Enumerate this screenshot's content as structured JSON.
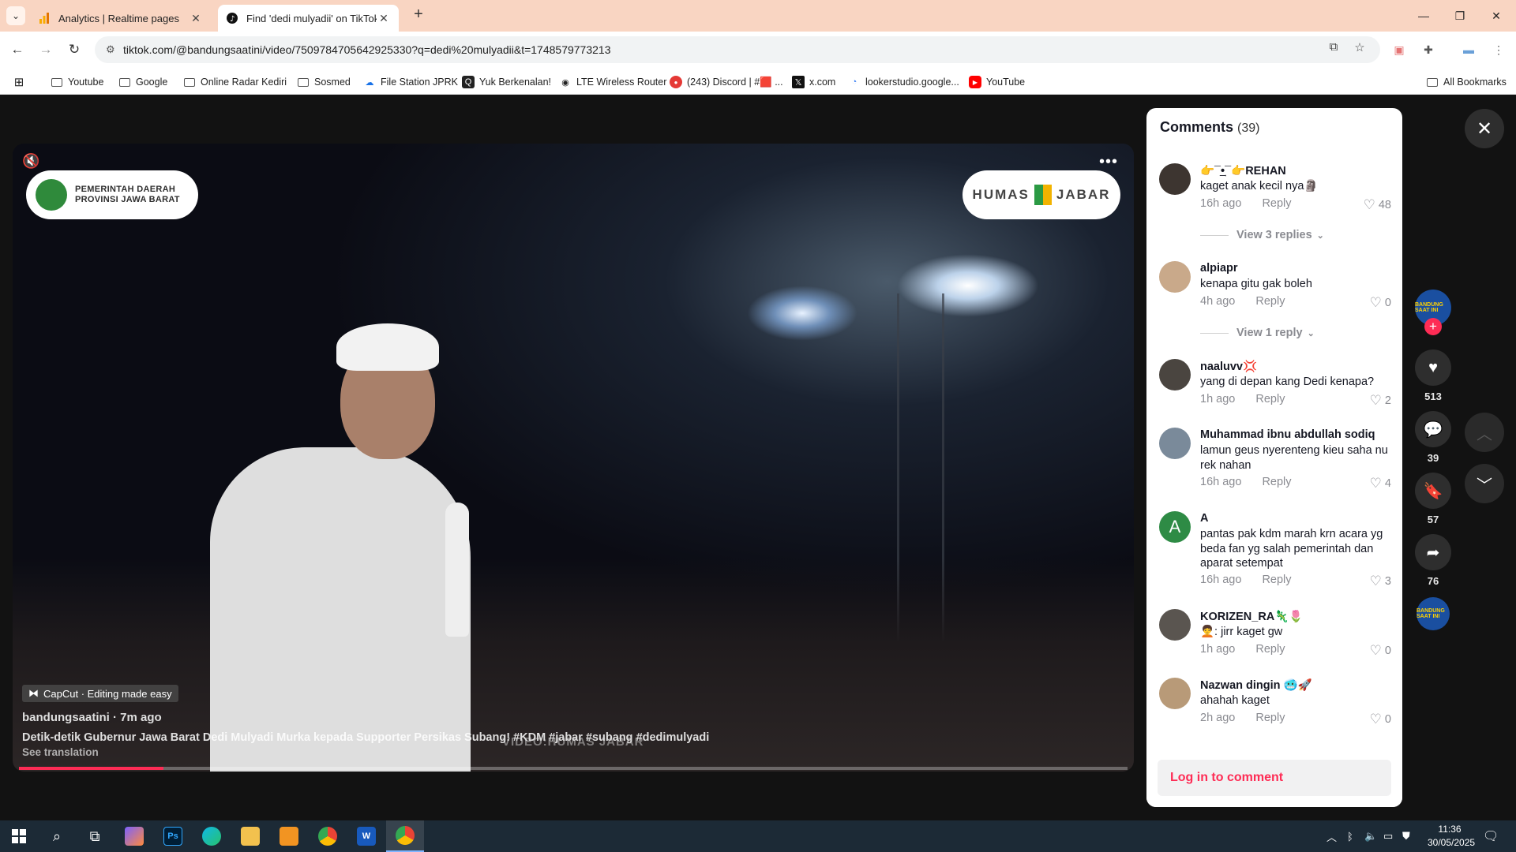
{
  "browser": {
    "tabs": [
      {
        "title": "Analytics | Realtime pages",
        "active": false,
        "icon": "analytics-icon"
      },
      {
        "title": "Find 'dedi mulyadii' on TikTok |",
        "active": true,
        "icon": "tiktok-icon"
      }
    ],
    "url": "tiktok.com/@bandungsaatini/video/7509784705642925330?q=dedi%20mulyadii&t=1748579773213",
    "bookmarks": [
      {
        "label": "Youtube",
        "icon": "folder-icon"
      },
      {
        "label": "Google",
        "icon": "folder-icon"
      },
      {
        "label": "Online Radar Kediri",
        "icon": "folder-icon"
      },
      {
        "label": "Sosmed",
        "icon": "folder-icon"
      },
      {
        "label": "File Station JPRK",
        "icon": "cloud-icon"
      },
      {
        "label": "Yuk Berkenalan!",
        "icon": "q-icon"
      },
      {
        "label": "LTE Wireless Router",
        "icon": "router-icon"
      },
      {
        "label": "(243) Discord | #🟥 ...",
        "icon": "discord-icon"
      },
      {
        "label": "x.com",
        "icon": "x-icon"
      },
      {
        "label": "lookerstudio.google...",
        "icon": "looker-icon"
      },
      {
        "label": "YouTube",
        "icon": "youtube-icon"
      }
    ],
    "all_bookmarks_label": "All Bookmarks"
  },
  "video": {
    "logo_left": "PEMERINTAH DAERAH\nPROVINSI JAWA BARAT",
    "logo_right_a": "HUMAS",
    "logo_right_b": "JABAR",
    "capcut_label": "CapCut · Editing made easy",
    "author_line": "bandungsaatini · 7m ago",
    "description": "Detik-detik Gubernur Jawa Barat Dedi Mulyadi Murka kepada Supporter Persikas Subang! #KDM #jabar #subang #dedimulyadi",
    "see_translation": "See translation",
    "watermark": "VIDEO:HUMAS JABAR",
    "progress": 0.13
  },
  "actions": {
    "avatar_text": "BANDUNG SAAT INI",
    "likes": "513",
    "comments": "39",
    "saves": "57",
    "shares": "76"
  },
  "comments_panel": {
    "title": "Comments",
    "count": "(39)",
    "items": [
      {
        "user": "👉¯͢•¯👉REHAN",
        "text": "kaget anak kecil nya🗿",
        "time": "16h ago",
        "reply": "Reply",
        "likes": "48",
        "view_replies": "View 3 replies"
      },
      {
        "user": "alpiapr",
        "text": "kenapa gitu gak boleh",
        "time": "4h ago",
        "reply": "Reply",
        "likes": "0",
        "view_replies": "View 1 reply"
      },
      {
        "user": "naaluvv💢",
        "text": "yang di depan kang Dedi kenapa?",
        "time": "1h ago",
        "reply": "Reply",
        "likes": "2"
      },
      {
        "user": "Muhammad ibnu abdullah sodiq",
        "text": "lamun geus nyerenteng kieu saha nu rek nahan",
        "time": "16h ago",
        "reply": "Reply",
        "likes": "4"
      },
      {
        "user": "A",
        "text": "pantas pak kdm marah krn acara yg beda fan yg salah pemerintah dan aparat setempat",
        "time": "16h ago",
        "reply": "Reply",
        "likes": "3",
        "avatar_letter": "A"
      },
      {
        "user": "KORIZEN_RA🦎🌷",
        "text": "🧑‍🦱: jirr kaget gw",
        "time": "1h ago",
        "reply": "Reply",
        "likes": "0"
      },
      {
        "user": "Nazwan dingin 🥶🚀",
        "text": "ahahah kaget",
        "time": "2h ago",
        "reply": "Reply",
        "likes": "0"
      }
    ],
    "login_label": "Log in to comment"
  },
  "taskbar": {
    "time": "11:36",
    "date": "30/05/2025"
  }
}
